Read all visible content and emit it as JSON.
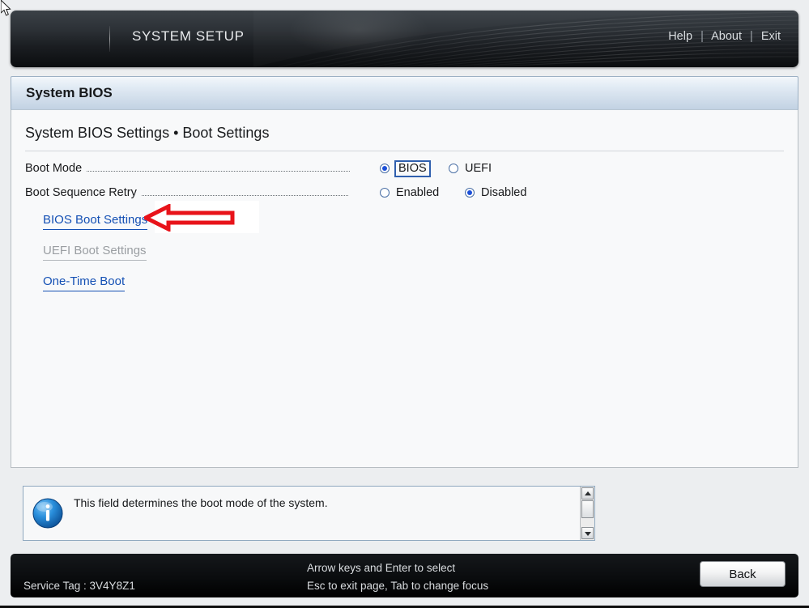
{
  "header": {
    "title": "SYSTEM SETUP",
    "links": [
      {
        "label": "Help"
      },
      {
        "label": "About"
      },
      {
        "label": "Exit"
      }
    ],
    "separator": "|"
  },
  "titlebar": {
    "text": "System BIOS"
  },
  "breadcrumb": {
    "text": "System BIOS Settings • Boot Settings"
  },
  "settings": [
    {
      "label": "Boot Mode",
      "options": [
        {
          "label": "BIOS",
          "selected": true,
          "focused": true
        },
        {
          "label": "UEFI",
          "selected": false,
          "focused": false
        }
      ]
    },
    {
      "label": "Boot Sequence Retry",
      "options": [
        {
          "label": "Enabled",
          "selected": false,
          "focused": false
        },
        {
          "label": "Disabled",
          "selected": true,
          "focused": false
        }
      ]
    }
  ],
  "links": [
    {
      "label": "BIOS Boot Settings",
      "enabled": true
    },
    {
      "label": "UEFI Boot Settings",
      "enabled": false
    },
    {
      "label": "One-Time Boot",
      "enabled": true
    }
  ],
  "info": {
    "icon": "info-icon",
    "text": "This field determines the boot mode of the system."
  },
  "footer": {
    "service_tag": "Service Tag : 3V4Y8Z1",
    "hint_line1": "Arrow keys and Enter to select",
    "hint_line2": "Esc to exit page, Tab to change focus",
    "back_label": "Back"
  },
  "annotation": {
    "shape": "left-arrow",
    "color": "#e8131a"
  },
  "colors": {
    "link": "#1450b4",
    "radio_selected": "#1b4fd8",
    "focus_border": "#2f5fae",
    "header_bg": "#1b1e22",
    "titlebar_bg": "#cfdcea"
  }
}
